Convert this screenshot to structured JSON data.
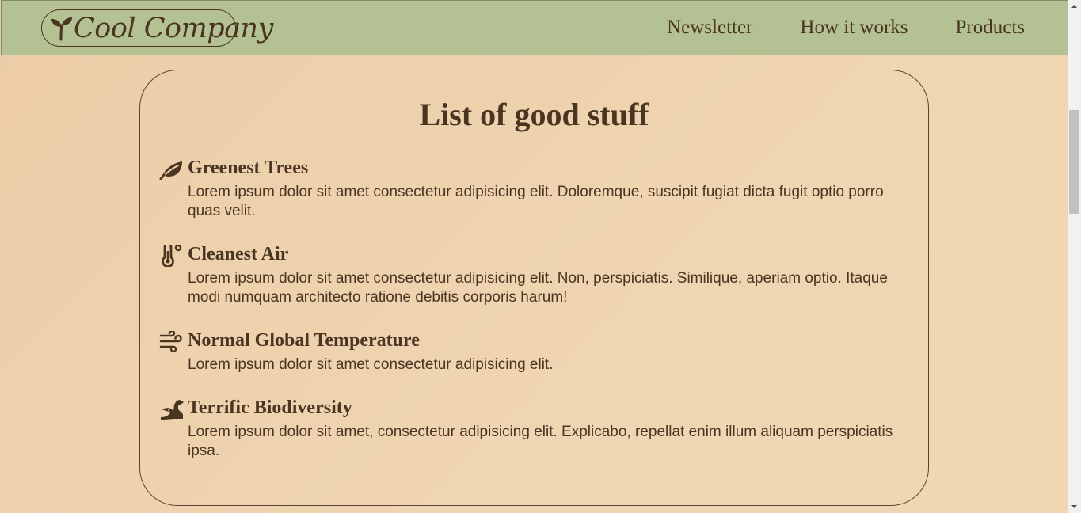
{
  "header": {
    "logo_text": "Cool Company",
    "nav": [
      {
        "label": "Newsletter"
      },
      {
        "label": "How it works"
      },
      {
        "label": "Products"
      }
    ]
  },
  "card": {
    "title": "List of good stuff",
    "items": [
      {
        "icon": "leaf-icon",
        "heading": "Greenest Trees",
        "text": "Lorem ipsum dolor sit amet consectetur adipisicing elit. Doloremque, suscipit fugiat dicta fugit optio porro quas velit."
      },
      {
        "icon": "thermometer-icon",
        "heading": "Cleanest Air",
        "text": "Lorem ipsum dolor sit amet consectetur adipisicing elit. Non, perspiciatis. Similique, aperiam optio. Itaque modi numquam architecto ratione debitis corporis harum!"
      },
      {
        "icon": "wind-icon",
        "heading": "Normal Global Temperature",
        "text": "Lorem ipsum dolor sit amet consectetur adipisicing elit."
      },
      {
        "icon": "dragon-icon",
        "heading": "Terrific Biodiversity",
        "text": "Lorem ipsum dolor sit amet, consectetur adipisicing elit. Explicabo, repellat enim illum aliquam perspiciatis ipsa."
      }
    ]
  },
  "colors": {
    "header_bg": "#b4c192",
    "page_bg": "#f0d5b2",
    "text": "#4a3521"
  }
}
